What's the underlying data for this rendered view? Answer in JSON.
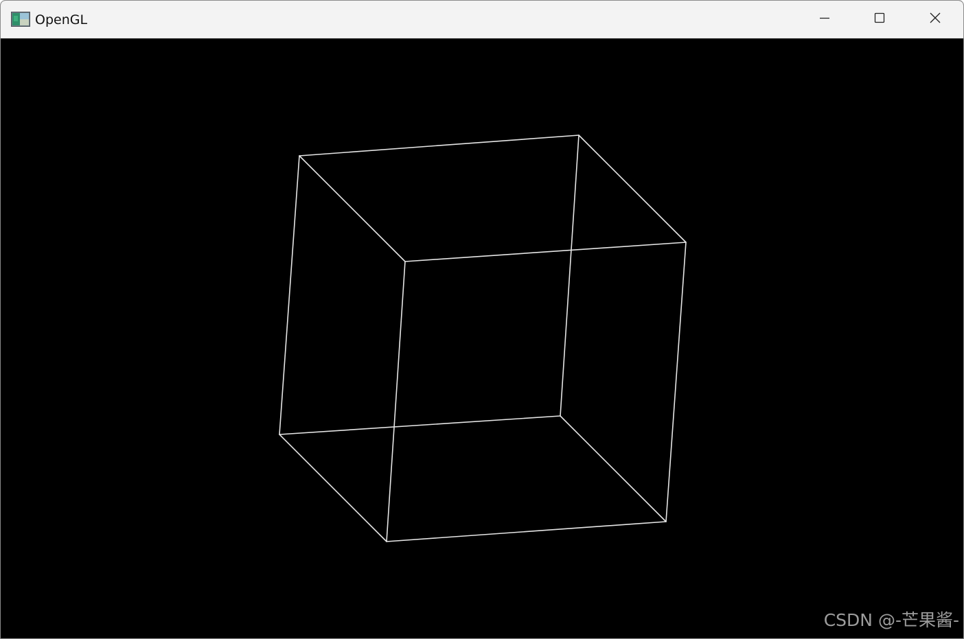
{
  "window": {
    "title": "OpenGL",
    "icon": "opengl-app-icon",
    "controls": {
      "minimize_icon": "minimize-icon",
      "maximize_icon": "maximize-icon",
      "close_icon": "close-icon"
    }
  },
  "scene": {
    "background_color": "#000000",
    "line_color": "#e6e6e6",
    "object": "wireframe-cube"
  },
  "watermark": {
    "text": "CSDN @-芒果酱-"
  }
}
